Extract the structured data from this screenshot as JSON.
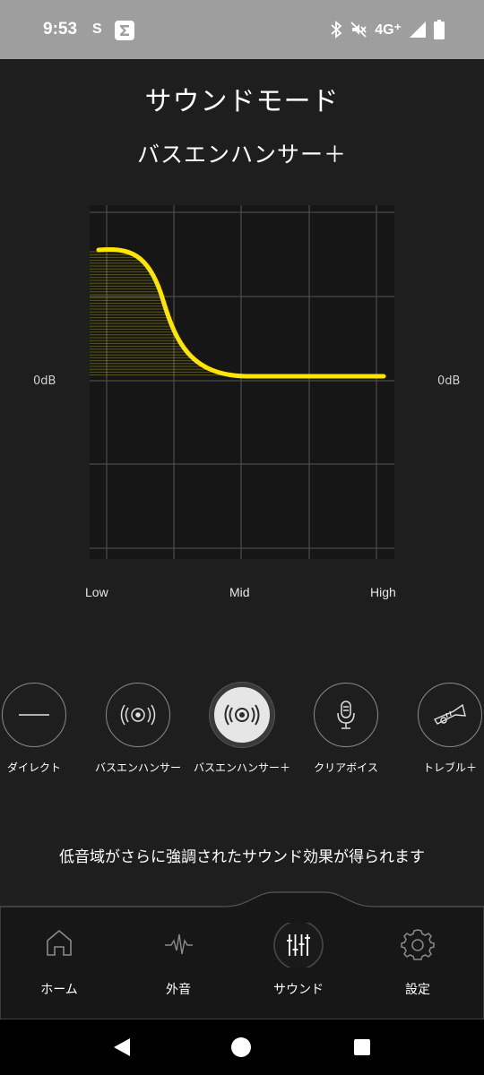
{
  "status_bar": {
    "time": "9:53",
    "app_glyph": "S",
    "sigma": "Σ",
    "network": "4G⁺"
  },
  "header": {
    "title": "サウンドモード",
    "mode_name": "バスエンハンサー＋"
  },
  "eq_chart": {
    "db_left": "0dB",
    "db_right": "0dB",
    "labels": {
      "low": "Low",
      "mid": "Mid",
      "high": "High"
    },
    "curve_color": "#ffe600"
  },
  "modes": [
    {
      "label": "ダイレクト",
      "icon": "line-icon",
      "active": false
    },
    {
      "label": "バスエンハンサー",
      "icon": "speaker-waves-icon",
      "active": false
    },
    {
      "label": "バスエンハンサー＋",
      "icon": "speaker-waves-icon",
      "active": true
    },
    {
      "label": "クリアボイス",
      "icon": "microphone-icon",
      "active": false
    },
    {
      "label": "トレブル＋",
      "icon": "trumpet-icon",
      "active": false
    }
  ],
  "description": "低音域がさらに強調されたサウンド効果が得られます",
  "bottom_nav": [
    {
      "label": "ホーム",
      "icon": "home-icon",
      "active": false
    },
    {
      "label": "外音",
      "icon": "waveform-icon",
      "active": false
    },
    {
      "label": "サウンド",
      "icon": "equalizer-icon",
      "active": true
    },
    {
      "label": "設定",
      "icon": "gear-icon",
      "active": false
    }
  ]
}
